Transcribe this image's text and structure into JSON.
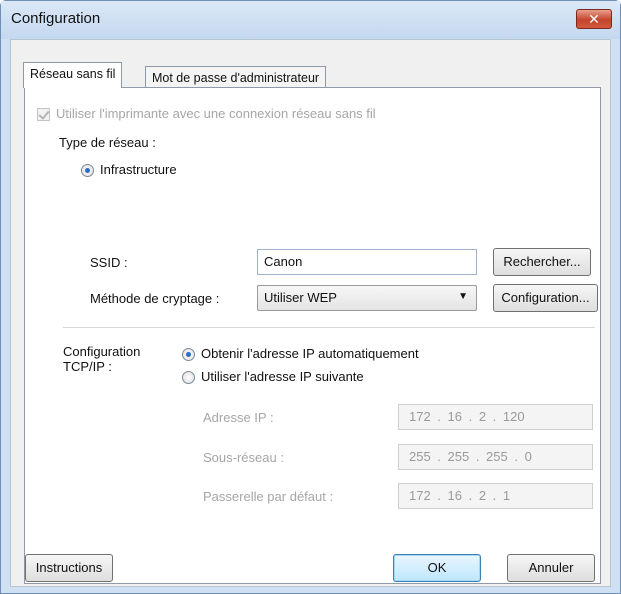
{
  "window": {
    "title": "Configuration",
    "close_symbol": "✕"
  },
  "tabs": [
    {
      "label": "Réseau sans fil",
      "active": true
    },
    {
      "label": "Mot de passe d'administrateur",
      "active": false
    }
  ],
  "wireless": {
    "use_wireless_label": "Utiliser l'imprimante avec une connexion réseau sans fil",
    "use_wireless_checked": true,
    "network_type_label": "Type de réseau :",
    "infrastructure_label": "Infrastructure",
    "ssid_label": "SSID :",
    "ssid_value": "Canon",
    "search_button": "Rechercher...",
    "encryption_label": "Méthode de cryptage :",
    "encryption_value": "Utiliser WEP",
    "config_button": "Configuration..."
  },
  "tcpip": {
    "label_line1": "Configuration",
    "label_line2": "TCP/IP :",
    "auto_ip_label": "Obtenir l'adresse IP automatiquement",
    "manual_ip_label": "Utiliser l'adresse IP suivante",
    "ip_label": "Adresse IP :",
    "ip_value": "172 . 16 . 2 . 120",
    "subnet_label": "Sous-réseau :",
    "subnet_value": "255 . 255 . 255 . 0",
    "gateway_label": "Passerelle par défaut :",
    "gateway_value": "172 . 16 . 2 . 1"
  },
  "footer": {
    "instructions_button": "Instructions",
    "ok_button": "OK",
    "cancel_button": "Annuler"
  }
}
